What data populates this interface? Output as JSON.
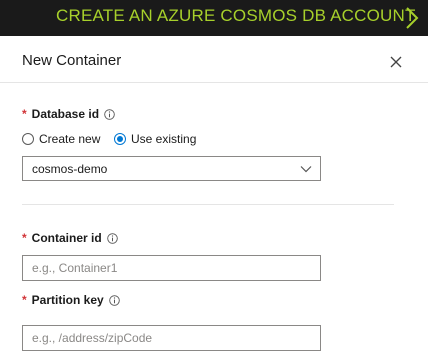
{
  "banner": {
    "title": "CREATE AN AZURE COSMOS DB ACCOUNT",
    "accent_color": "#a7d02b"
  },
  "blade": {
    "title": "New Container",
    "close_icon": "close-icon"
  },
  "database_id": {
    "label": "Database id",
    "required_mark": "*",
    "options": {
      "create_new": "Create new",
      "use_existing": "Use existing"
    },
    "selected_option": "use_existing",
    "selected_value": "cosmos-demo"
  },
  "container_id": {
    "label": "Container id",
    "required_mark": "*",
    "placeholder": "e.g., Container1",
    "value": ""
  },
  "partition_key": {
    "label": "Partition key",
    "required_mark": "*",
    "placeholder": "e.g., /address/zipCode",
    "value": ""
  },
  "colors": {
    "required": "#d13438",
    "primary": "#0078d4"
  }
}
